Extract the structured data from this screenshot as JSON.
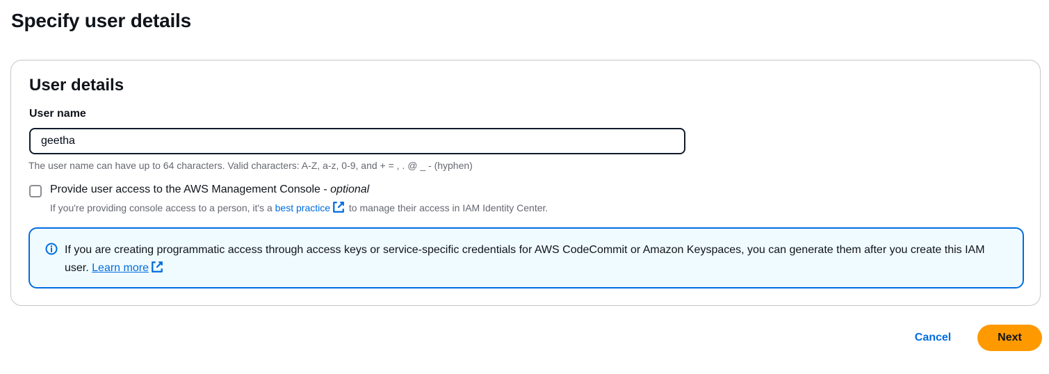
{
  "page": {
    "title": "Specify user details"
  },
  "user_details": {
    "section_title": "User details",
    "user_name": {
      "label": "User name",
      "value": "geetha",
      "constraint": "The user name can have up to 64 characters. Valid characters: A-Z, a-z, 0-9, and + = , . @ _ - (hyphen)"
    },
    "console_access": {
      "label": "Provide user access to the AWS Management Console - ",
      "optional": "optional",
      "checked": false,
      "desc_before": "If you're providing console access to a person, it's a ",
      "desc_link": "best practice",
      "desc_after": " to manage their access in IAM Identity Center."
    },
    "info_alert": {
      "text": "If you are creating programmatic access through access keys or service-specific credentials for AWS CodeCommit or Amazon Keyspaces, you can generate them after you create this IAM user. ",
      "link": "Learn more"
    }
  },
  "actions": {
    "cancel_label": "Cancel",
    "next_label": "Next"
  },
  "icons": {
    "external_link": "external-link-icon",
    "info": "info-icon"
  },
  "colors": {
    "link": "#006ce0",
    "primary_button": "#ff9900",
    "alert_border": "#006ce0",
    "alert_background": "#f0fbff"
  }
}
